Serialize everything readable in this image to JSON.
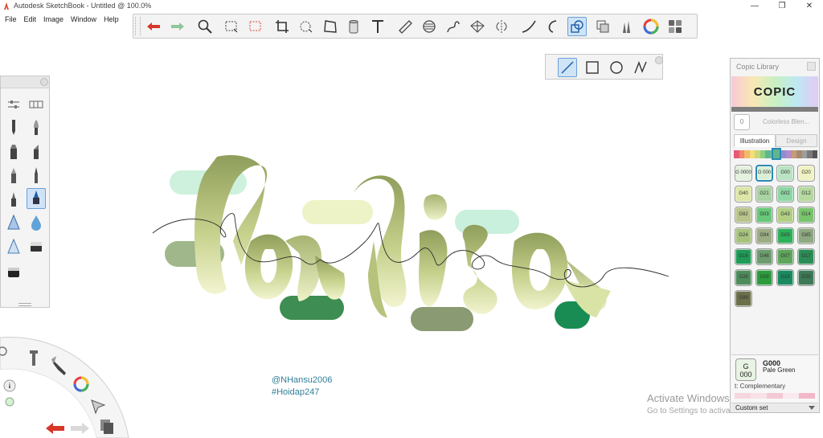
{
  "window": {
    "title": "Autodesk SketchBook - Untitled @ 100.0%",
    "minimize": "—",
    "maximize": "❐",
    "close": "✕"
  },
  "menu": [
    "File",
    "Edit",
    "Image",
    "Window",
    "Help"
  ],
  "toolbar": {
    "tools": [
      "undo-icon",
      "redo-icon",
      "zoom-icon",
      "rect-select-icon",
      "lasso-select-icon",
      "crop-icon",
      "quick-select-icon",
      "distort-icon",
      "fill-icon",
      "text-icon",
      "ruler-icon",
      "ellipse-guide-icon",
      "french-curve-icon",
      "perspective-icon",
      "symmetry-icon",
      "stroke-stabilizer-icon",
      "predictive-stroke-icon",
      "shape-tool-icon",
      "layers-icon",
      "brush-library-icon",
      "color-wheel-icon",
      "copic-library-icon"
    ],
    "active_tool": "shape-tool-icon"
  },
  "shape_toolbar": {
    "tools": [
      "line-shape-icon",
      "rectangle-shape-icon",
      "circle-shape-icon",
      "polyline-shape-icon"
    ],
    "active_tool": "line-shape-icon"
  },
  "canvas": {
    "credit_handle": "@NHansu2006",
    "credit_tag": "#Hoidap247"
  },
  "watermark": {
    "line1": "Activate Windows",
    "line2": "Go to Settings to activate Windows."
  },
  "copic": {
    "title": "Copic Library",
    "logo": "COPIC",
    "blender_code": "0",
    "blender_label": "Colorless Blen...",
    "tab_illustration": "Illustration",
    "tab_design": "Design",
    "swatches": [
      {
        "code": "G 0000",
        "color": "#e4f1df"
      },
      {
        "code": "G 000",
        "color": "#d9efd6",
        "selected": true
      },
      {
        "code": "G00",
        "color": "#b9e3c3"
      },
      {
        "code": "G20",
        "color": "#f1f2c3"
      },
      {
        "code": "G40",
        "color": "#dde6a8"
      },
      {
        "code": "G21",
        "color": "#a9d3a2"
      },
      {
        "code": "G02",
        "color": "#8ed6a3"
      },
      {
        "code": "G12",
        "color": "#b6d99f"
      },
      {
        "code": "G82",
        "color": "#b8c48b"
      },
      {
        "code": "G03",
        "color": "#66c878"
      },
      {
        "code": "G43",
        "color": "#b0cf83"
      },
      {
        "code": "G14",
        "color": "#79c46b"
      },
      {
        "code": "G24",
        "color": "#a7c27e"
      },
      {
        "code": "G94",
        "color": "#9cad84"
      },
      {
        "code": "G05",
        "color": "#2fb05a"
      },
      {
        "code": "G85",
        "color": "#8ea880"
      },
      {
        "code": "G16",
        "color": "#1f9b57"
      },
      {
        "code": "G46",
        "color": "#6d9c71"
      },
      {
        "code": "G07",
        "color": "#5fa55d"
      },
      {
        "code": "G17",
        "color": "#2a8d55"
      },
      {
        "code": "G28",
        "color": "#4f8c5b"
      },
      {
        "code": "G09",
        "color": "#2d9c3e"
      },
      {
        "code": "G19",
        "color": "#1b8a60"
      },
      {
        "code": "G29",
        "color": "#3e7a57"
      },
      {
        "code": "G99",
        "color": "#6b6f4a"
      }
    ],
    "current_code_top": "G",
    "current_code_bottom": "000",
    "current_id": "G000",
    "current_name": "Pale Green",
    "complementary_label": "t: Complementary",
    "set_label": "Custom set"
  }
}
